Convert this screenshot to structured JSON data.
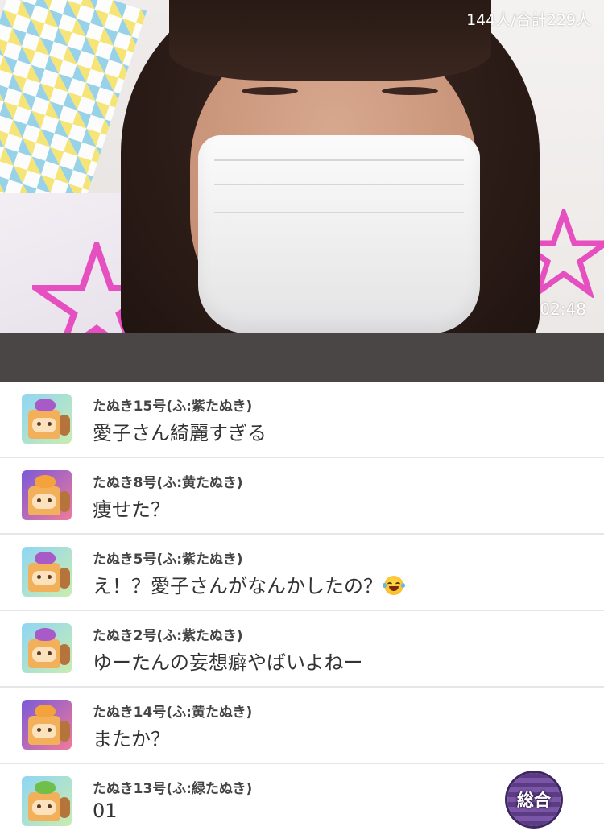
{
  "stream": {
    "viewer_count": "144人/合計229人",
    "elapsed_time": "02:48"
  },
  "comments": [
    {
      "author": "たぬき15号(ふ:紫たぬき)",
      "message": "愛子さん綺麗すぎる",
      "avatar_leaf": "purple",
      "avatar_bg": "a"
    },
    {
      "author": "たぬき8号(ふ:黄たぬき)",
      "message": "痩せた？",
      "avatar_leaf": "yellow",
      "avatar_bg": "b"
    },
    {
      "author": "たぬき5号(ふ:紫たぬき)",
      "message": "え！？愛子さんがなんかしたの？",
      "avatar_leaf": "purple",
      "avatar_bg": "a",
      "emoji": "joy-tears-emoji"
    },
    {
      "author": "たぬき2号(ふ:紫たぬき)",
      "message": "ゆーたんの妄想癖やばいよねー",
      "avatar_leaf": "purple",
      "avatar_bg": "a"
    },
    {
      "author": "たぬき14号(ふ:黄たぬき)",
      "message": "またか？",
      "avatar_leaf": "yellow",
      "avatar_bg": "b"
    },
    {
      "author": "たぬき13号(ふ:緑たぬき)",
      "message": "01",
      "avatar_leaf": "green",
      "avatar_bg": "a"
    }
  ],
  "overall_button": {
    "label": "総合"
  },
  "colors": {
    "divider": "#e6e6e6",
    "dark_bar": "#4a4645",
    "badge": "#5b3c82"
  }
}
